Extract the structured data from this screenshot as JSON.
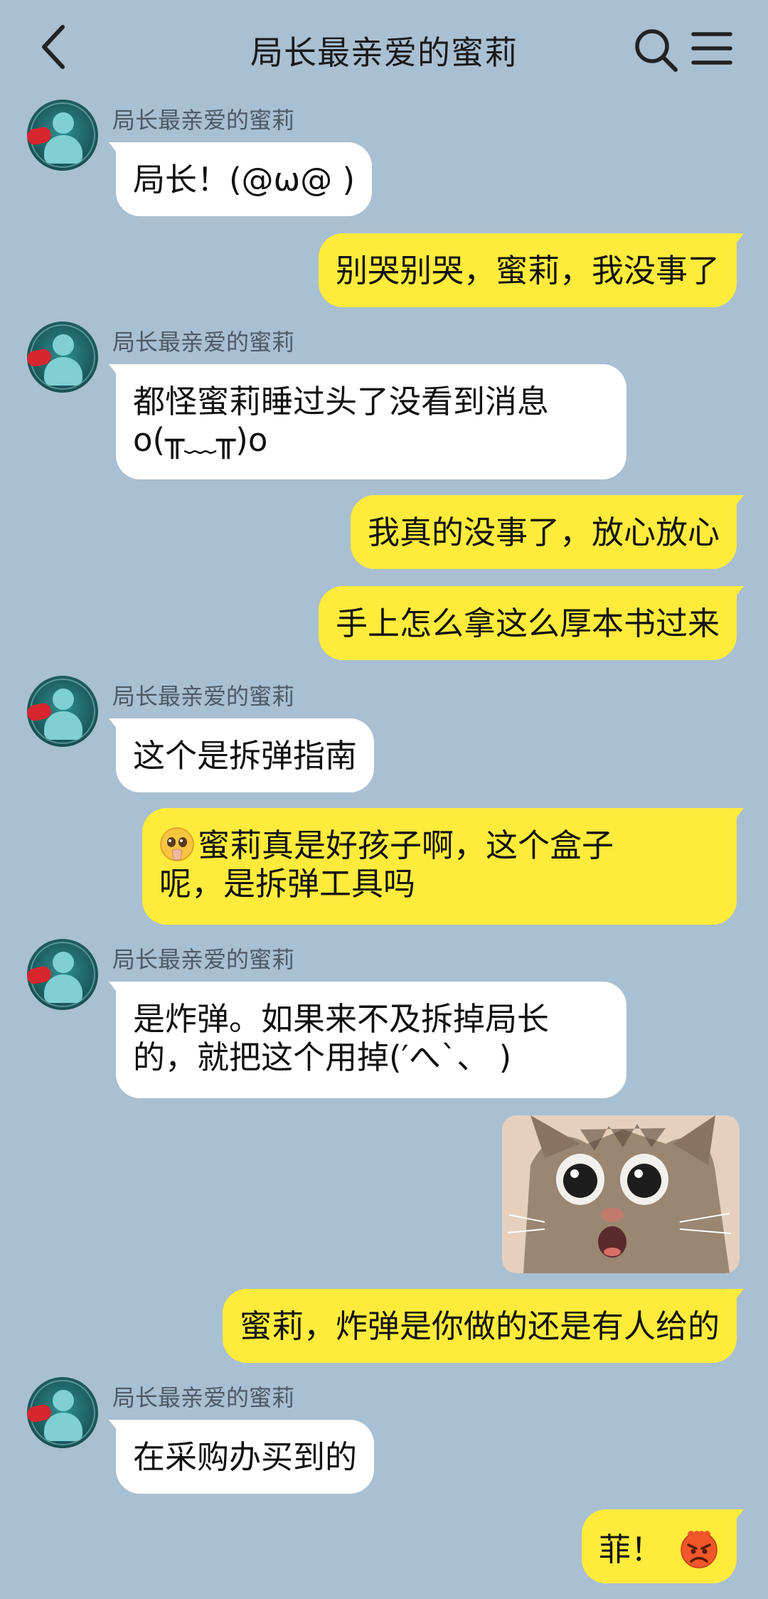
{
  "header": {
    "title": "局长最亲爱的蜜莉",
    "back_icon": "chevron-left-icon",
    "search_icon": "search-icon",
    "menu_icon": "menu-icon"
  },
  "messages": [
    {
      "side": "left",
      "sender": "局长最亲爱的蜜莉",
      "text": "局长！(@ω@ )"
    },
    {
      "side": "right",
      "text": "别哭别哭，蜜莉，我没事了"
    },
    {
      "side": "left",
      "sender": "局长最亲爱的蜜莉",
      "line1": "都怪蜜莉睡过头了没看到消息",
      "line2": "o(╥﹏╥)o"
    },
    {
      "side": "right",
      "text": "我真的没事了，放心放心"
    },
    {
      "side": "right",
      "text": "手上怎么拿这么厚本书过来"
    },
    {
      "side": "left",
      "sender": "局长最亲爱的蜜莉",
      "text": "这个是拆弹指南"
    },
    {
      "side": "right",
      "emoji": "pleading-face-icon",
      "line1": "蜜莉真是好孩子啊，这个盒子",
      "line2": "呢，是拆弹工具吗"
    },
    {
      "side": "left",
      "sender": "局长最亲爱的蜜莉",
      "line1": "是炸弹。如果来不及拆掉局长",
      "line2": "的，就把这个用掉(′へ`、 )"
    },
    {
      "side": "right",
      "type": "image",
      "image": "shocked-cat-photo"
    },
    {
      "side": "right",
      "text": "蜜莉，炸弹是你做的还是有人给的"
    },
    {
      "side": "left",
      "sender": "局长最亲爱的蜜莉",
      "text": "在采购办买到的"
    },
    {
      "side": "right",
      "text": "菲！",
      "emoji": "angry-face-icon"
    }
  ],
  "colors": {
    "background": "#a9bfd2",
    "left_bubble": "#ffffff",
    "right_bubble": "#ffeb3b"
  }
}
